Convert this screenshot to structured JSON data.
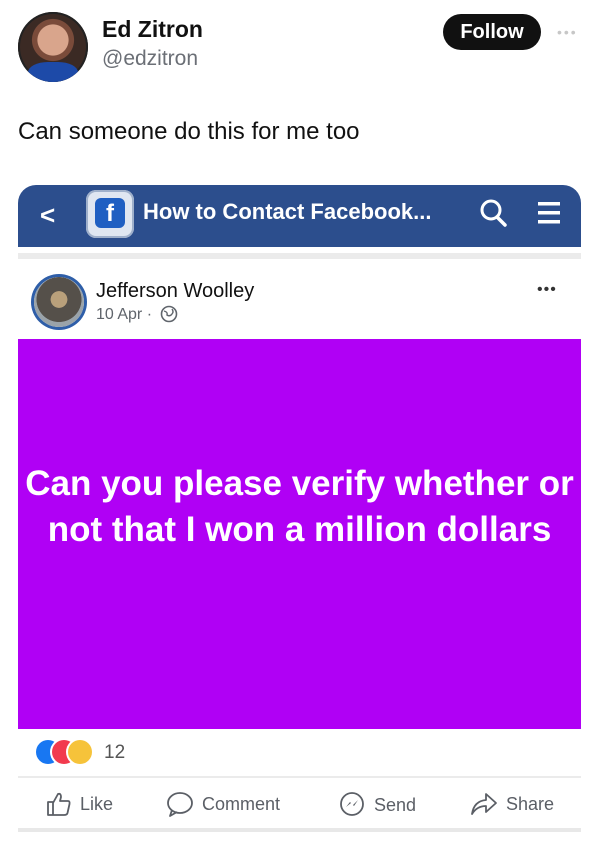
{
  "tweet": {
    "author_name": "Ed Zitron",
    "author_handle": "@edzitron",
    "follow_label": "Follow",
    "text": "Can someone do this for me too"
  },
  "facebook_screenshot": {
    "header_title": "How to Contact Facebook...",
    "post": {
      "author": "Jefferson Woolley",
      "date": "10 Apr ·",
      "message": "Can you please verify whether or not that I won a million dollars",
      "background_color": "#b000f5",
      "reaction_count": "12"
    },
    "actions": {
      "like": "Like",
      "comment": "Comment",
      "send": "Send",
      "share": "Share"
    }
  },
  "colors": {
    "fb_blue": "#2c4e8d",
    "follow_bg": "#111111"
  }
}
